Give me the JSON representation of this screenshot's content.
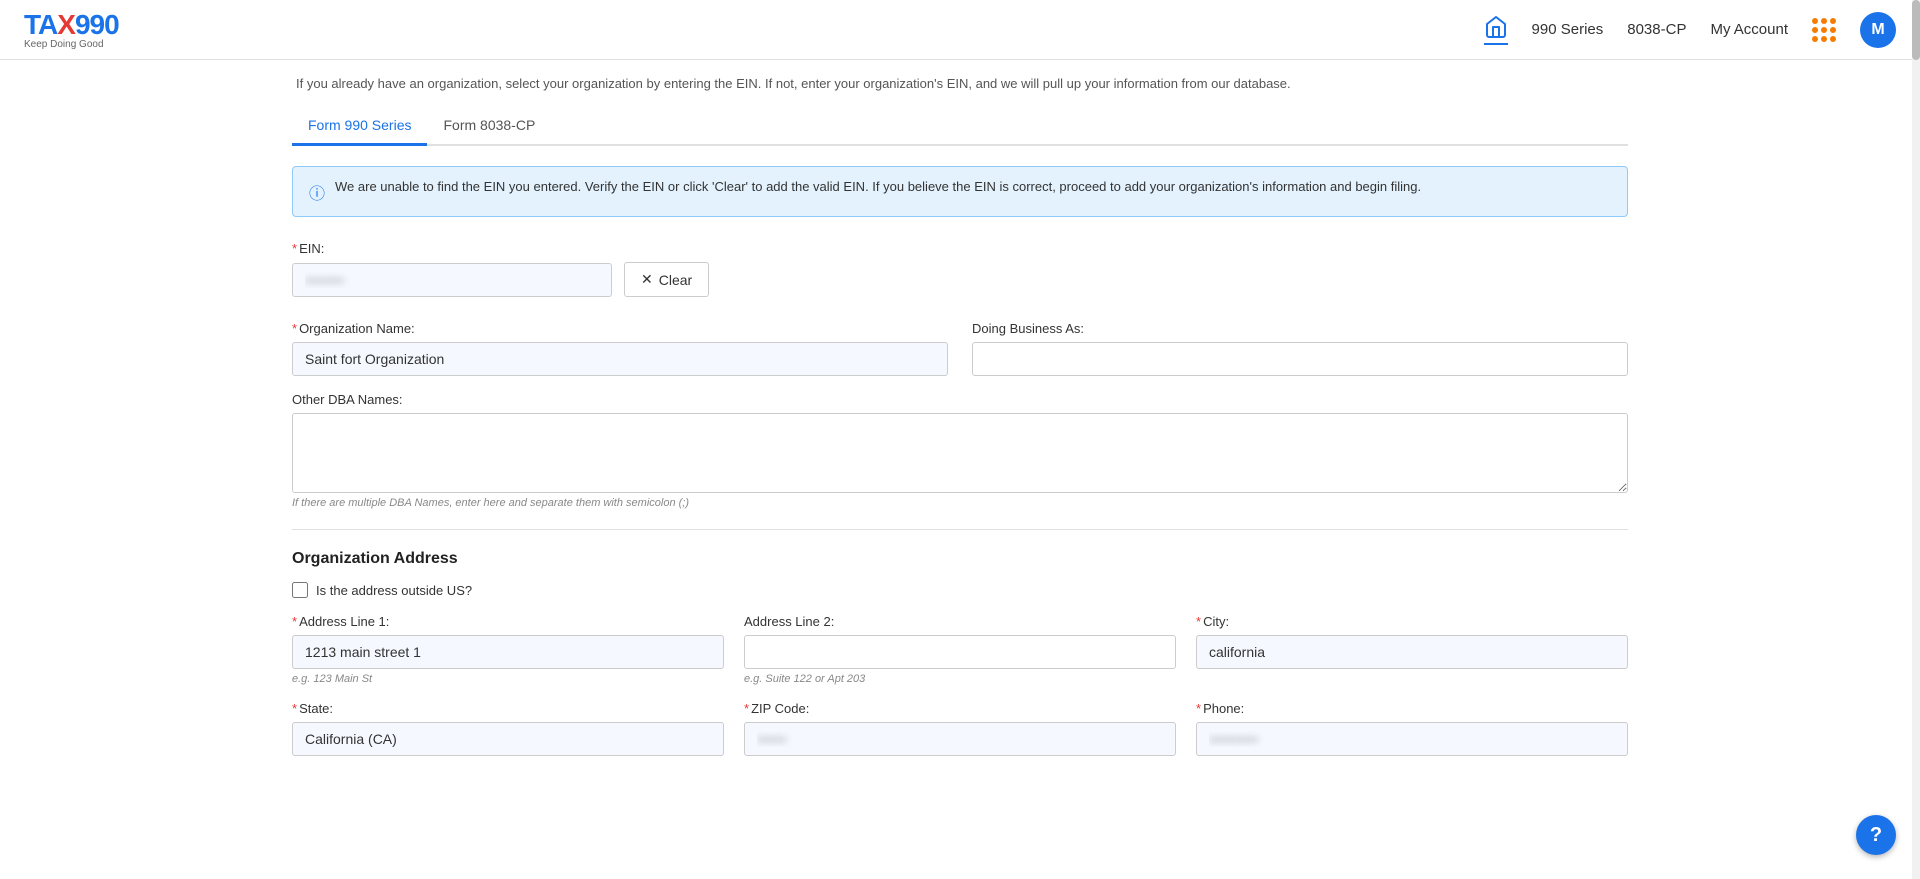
{
  "app": {
    "logo": {
      "prefix": "TA",
      "x": "X",
      "suffix": "990",
      "tagline": "Keep Doing Good"
    },
    "nav": {
      "home_label": "Home",
      "series_label": "990 Series",
      "form_8038_label": "8038-CP",
      "my_account_label": "My Account",
      "avatar_letter": "M"
    }
  },
  "page": {
    "info_text": "If you already have an organization, select your organization by entering the EIN. If not, enter your organization's EIN, and we will pull up your information from our database.",
    "tabs": [
      {
        "label": "Form 990 Series",
        "active": true
      },
      {
        "label": "Form 8038-CP",
        "active": false
      }
    ],
    "alert": {
      "message": "We are unable to find the EIN you entered. Verify the EIN or click 'Clear' to add the valid EIN. If you believe the EIN is correct, proceed to add your organization's information and begin filing."
    },
    "ein_section": {
      "label": "EIN:",
      "value_placeholder": "••••••••",
      "clear_button": "Clear"
    },
    "org_name_section": {
      "label": "Organization Name:",
      "value": "Saint fort Organization",
      "dba_label": "Doing Business As:",
      "dba_value": "",
      "other_dba_label": "Other DBA Names:",
      "other_dba_value": "",
      "dba_hint": "If there are multiple DBA Names, enter here and separate them with semicolon (;)"
    },
    "address_section": {
      "title": "Organization Address",
      "outside_us_label": "Is the address outside US?",
      "address1_label": "Address Line 1:",
      "address1_value": "1213 main street 1",
      "address1_hint": "e.g. 123 Main St",
      "address2_label": "Address Line 2:",
      "address2_value": "",
      "address2_hint": "e.g. Suite 122 or Apt 203",
      "city_label": "City:",
      "city_value": "california",
      "state_label": "State:",
      "state_value": "California (CA)",
      "zip_label": "ZIP Code:",
      "zip_value": "••••••",
      "phone_label": "Phone:",
      "phone_value": "••••••••••"
    }
  }
}
